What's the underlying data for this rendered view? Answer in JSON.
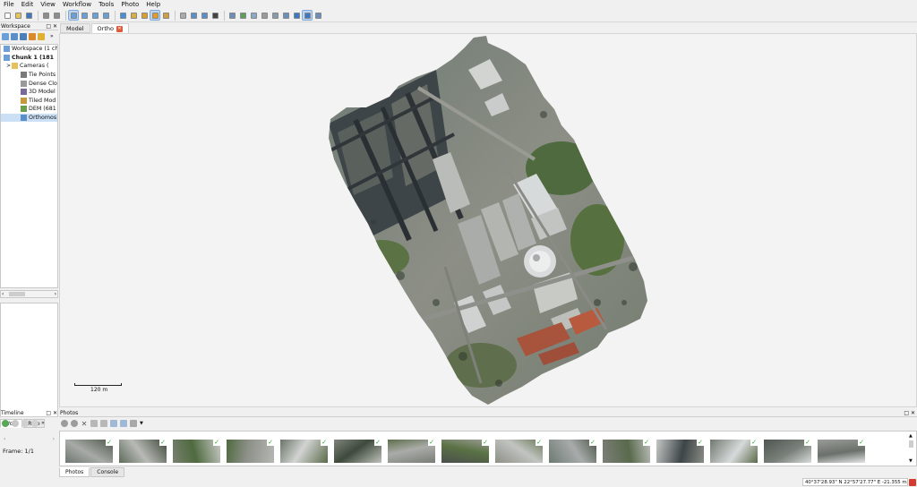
{
  "menu": [
    "File",
    "Edit",
    "View",
    "Workflow",
    "Tools",
    "Photo",
    "Help"
  ],
  "toolbar": {
    "icons": [
      "new-icon",
      "open-icon",
      "save-icon",
      "undo-icon",
      "redo-icon",
      "navigate-icon",
      "move-icon",
      "rotate-icon",
      "select-icon",
      "rectangle-icon",
      "ruler-icon",
      "marker-icon",
      "shape-icon",
      "sphere-icon",
      "refresh-icon",
      "zoom-in-icon",
      "zoom-out-icon",
      "pie-icon",
      "grid-icon",
      "layers-icon",
      "thumbs-icon",
      "cloud-icon",
      "texture-icon",
      "tiled-icon",
      "dem-icon",
      "ortho-icon",
      "pointer-icon"
    ],
    "selected": [
      5,
      12,
      25
    ]
  },
  "workspace": {
    "title": "Workspace",
    "tree": [
      {
        "label": "Workspace (1 chu",
        "indent": 1,
        "icon": "workspace-icon",
        "bold": false
      },
      {
        "label": "Chunk 1 (181",
        "indent": 1,
        "icon": "chunk-icon",
        "bold": true,
        "expander": "v"
      },
      {
        "label": "Cameras (",
        "indent": 2,
        "icon": "folder-icon",
        "expander": ">"
      },
      {
        "label": "Tie Points",
        "indent": 3,
        "icon": "tiepoints-icon"
      },
      {
        "label": "Dense Clo",
        "indent": 3,
        "icon": "dense-cloud-icon"
      },
      {
        "label": "3D Model",
        "indent": 3,
        "icon": "model-icon"
      },
      {
        "label": "Tiled Mod",
        "indent": 3,
        "icon": "tiled-model-icon"
      },
      {
        "label": "DEM (681",
        "indent": 3,
        "icon": "dem-icon"
      },
      {
        "label": "Orthomos",
        "indent": 3,
        "icon": "orthomosaic-icon",
        "selected": true
      }
    ],
    "tabs": [
      "Work",
      "Refe"
    ]
  },
  "view_tabs": [
    {
      "label": "Model",
      "active": false
    },
    {
      "label": "Ortho",
      "active": true,
      "closable": true
    }
  ],
  "scalebar": {
    "label": "120 m"
  },
  "timeline": {
    "title": "Timeline",
    "frame": "Frame: 1/1"
  },
  "photos": {
    "title": "Photos",
    "count": 15,
    "tabs": [
      "Photos",
      "Console"
    ]
  },
  "status": {
    "coords": "40°37'28.93\" N  22°57'27.77\" E  -21.355 m"
  }
}
